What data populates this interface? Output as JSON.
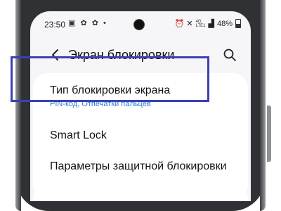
{
  "status_bar": {
    "time": "23:50",
    "notification_icons": "▣ ✿ ✿ •",
    "right_icons": "⏰ ✕",
    "network_top": "4G",
    "network_bottom": "LTE1",
    "battery": "48%"
  },
  "header": {
    "title": "Экран блокировки"
  },
  "settings": [
    {
      "title": "Тип блокировки экрана",
      "subtitle": "PIN-код, Отпечатки пальцев"
    },
    {
      "title": "Smart Lock"
    },
    {
      "title": "Параметры защитной блокировки"
    }
  ],
  "colors": {
    "highlight_border": "#3d3fb4",
    "subtitle": "#2a7ad2",
    "screen_bg": "#f6f6f8"
  }
}
